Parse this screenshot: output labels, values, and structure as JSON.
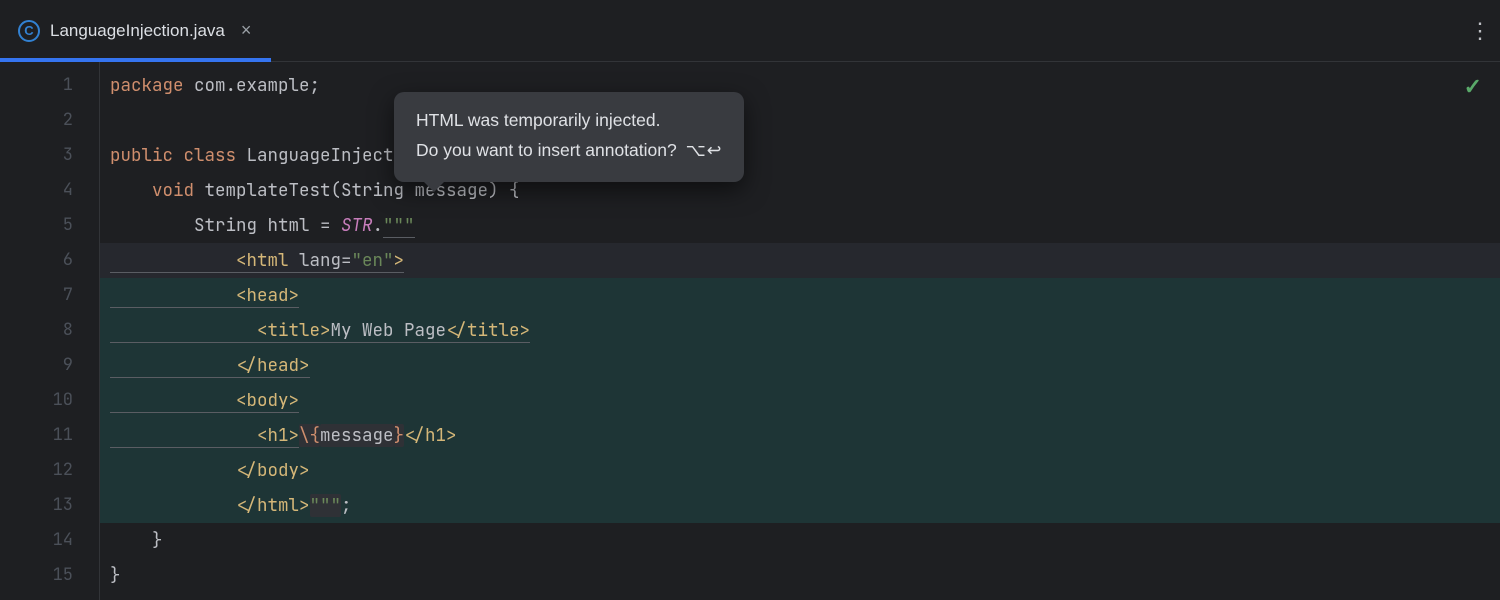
{
  "tab": {
    "filename": "LanguageInjection.java",
    "file_icon_letter": "C"
  },
  "popup": {
    "line1": "HTML was temporarily injected.",
    "line2": "Do you want to insert annotation?",
    "shortcut": "⌥↩"
  },
  "status": {
    "ok_glyph": "✓"
  },
  "gutter": {
    "lines": [
      "1",
      "2",
      "3",
      "4",
      "5",
      "6",
      "7",
      "8",
      "9",
      "10",
      "11",
      "12",
      "13",
      "14",
      "15"
    ]
  },
  "code": {
    "l1": {
      "kw": "package",
      "rest": " com.example;"
    },
    "l3": {
      "kw1": "public",
      "kw2": "class",
      "name": " LanguageInjection {"
    },
    "l4": {
      "kw": "void",
      "name": " templateTest(String message) {"
    },
    "l5": {
      "pre": "String html = ",
      "tpl": "STR",
      "dot": ".",
      "quotes": "\"\"\""
    },
    "l6": {
      "open": "<html",
      "attr": " lang",
      "eq": "=",
      "val": "\"en\"",
      "close": ">"
    },
    "l7": {
      "tag": "<head>"
    },
    "l8": {
      "open": "<title>",
      "text": "My Web Page",
      "close": "</title>"
    },
    "l9": {
      "tag": "</head>"
    },
    "l10": {
      "tag": "<body>"
    },
    "l11": {
      "open": "<h1>",
      "esc": "\\{",
      "var": "message",
      "esc2": "}",
      "close": "</h1>"
    },
    "l12": {
      "tag": "</body>"
    },
    "l13": {
      "tag": "</html>",
      "quotes": "\"\"\"",
      "semi": ";"
    },
    "l14": {
      "brace": "}"
    },
    "l15": {
      "brace": "}"
    }
  }
}
